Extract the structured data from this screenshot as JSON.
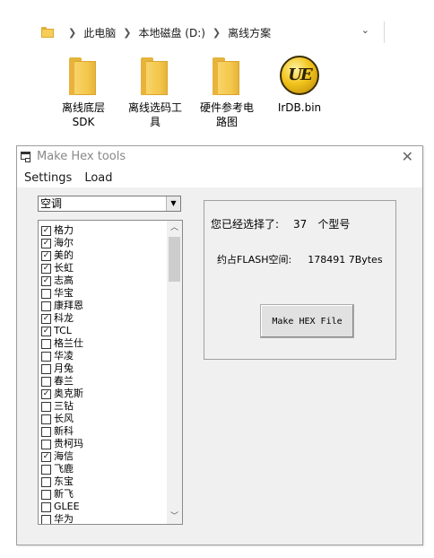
{
  "explorer": {
    "breadcrumb": [
      "此电脑",
      "本地磁盘 (D:)",
      "离线方案"
    ],
    "files": [
      {
        "name": "离线底层\nSDK",
        "icon": "folder-icon"
      },
      {
        "name": "离线选码工\n具",
        "icon": "folder-icon"
      },
      {
        "name": "硬件参考电\n路图",
        "icon": "folder-icon"
      },
      {
        "name": "IrDB.bin",
        "icon": "ultraedit-icon",
        "logo_text": "UE"
      }
    ]
  },
  "window": {
    "title": "Make Hex tools",
    "menu": [
      "Settings",
      "Load"
    ],
    "category": "空调",
    "brands": [
      {
        "name": "格力",
        "checked": true
      },
      {
        "name": "海尔",
        "checked": true
      },
      {
        "name": "美的",
        "checked": true
      },
      {
        "name": "长虹",
        "checked": true
      },
      {
        "name": "志高",
        "checked": true
      },
      {
        "name": "华宝",
        "checked": false
      },
      {
        "name": "康拜恩",
        "checked": false
      },
      {
        "name": "科龙",
        "checked": true
      },
      {
        "name": "TCL",
        "checked": true
      },
      {
        "name": "格兰仕",
        "checked": false
      },
      {
        "name": "华凌",
        "checked": false
      },
      {
        "name": "月兔",
        "checked": false
      },
      {
        "name": "春兰",
        "checked": false
      },
      {
        "name": "奥克斯",
        "checked": true
      },
      {
        "name": "三钻",
        "checked": false
      },
      {
        "name": "长风",
        "checked": false
      },
      {
        "name": "新科",
        "checked": false
      },
      {
        "name": "贵柯玛",
        "checked": false
      },
      {
        "name": "海信",
        "checked": true
      },
      {
        "name": "飞鹿",
        "checked": false
      },
      {
        "name": "东宝",
        "checked": false
      },
      {
        "name": "新飞",
        "checked": false
      },
      {
        "name": "GLEE",
        "checked": false
      },
      {
        "name": "华为",
        "checked": false
      }
    ],
    "info": {
      "selected_label": "您已经选择了:",
      "selected_count": "37",
      "selected_unit": "个型号",
      "flash_label": "约占FLASH空间:",
      "flash_bytes": "178491 7Bytes"
    },
    "make_button": "Make HEX File"
  }
}
